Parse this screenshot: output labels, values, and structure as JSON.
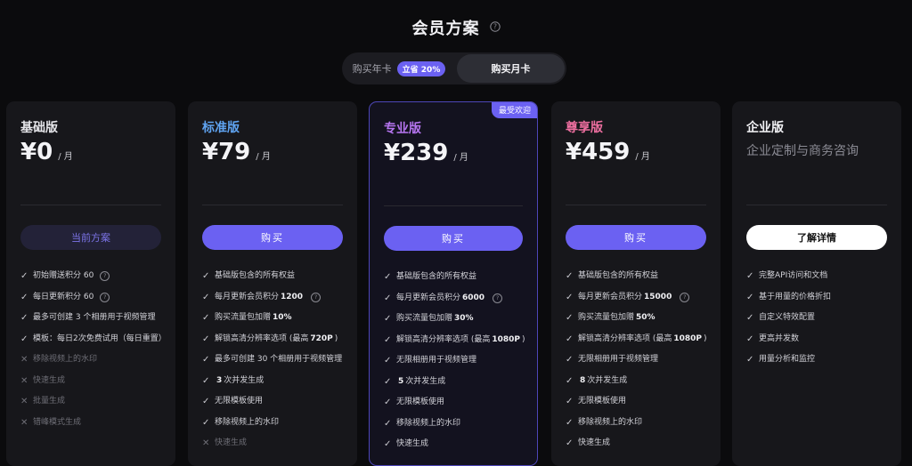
{
  "header": {
    "title": "会员方案"
  },
  "toggle": {
    "yearly": "购买年卡",
    "discount": "立省 20%",
    "monthly": "购买月卡"
  },
  "colors": {
    "accent": "#6b61f2",
    "basic": "#e6e6ea",
    "standard": "#5fa3f0",
    "pro": "#b675f0",
    "premium": "#ee6fa0",
    "enterprise": "#f2f2f5"
  },
  "plans": [
    {
      "name": "基础版",
      "price": "¥0",
      "unit": "/ 月",
      "cta": "当前方案",
      "features": [
        {
          "pre": "初始赠送积分 60",
          "bold": "",
          "post": "",
          "help": true,
          "ok": true
        },
        {
          "pre": "每日更新积分 60",
          "bold": "",
          "post": "",
          "help": true,
          "ok": true
        },
        {
          "pre": "最多可创建 3 个相册用于视频管理",
          "bold": "",
          "post": "",
          "help": false,
          "ok": true
        },
        {
          "pre": "模板：每日2次免费试用（每日重置）",
          "bold": "",
          "post": "",
          "help": false,
          "ok": true
        },
        {
          "pre": "移除视频上的水印",
          "bold": "",
          "post": "",
          "help": false,
          "ok": false
        },
        {
          "pre": "快速生成",
          "bold": "",
          "post": "",
          "help": false,
          "ok": false
        },
        {
          "pre": "批量生成",
          "bold": "",
          "post": "",
          "help": false,
          "ok": false
        },
        {
          "pre": "错峰模式生成",
          "bold": "",
          "post": "",
          "help": false,
          "ok": false
        }
      ]
    },
    {
      "name": "标准版",
      "price": "¥79",
      "unit": "/ 月",
      "cta": "购买",
      "features": [
        {
          "pre": "基础版包含的所有权益",
          "bold": "",
          "post": "",
          "help": false,
          "ok": true
        },
        {
          "pre": "每月更新会员积分",
          "bold": "1200",
          "post": "",
          "help": true,
          "ok": true
        },
        {
          "pre": "购买流量包加赠",
          "bold": "10%",
          "post": "",
          "help": false,
          "ok": true
        },
        {
          "pre": "解锁高清分辨率选项 (最高",
          "bold": "720P",
          "post": ")",
          "help": false,
          "ok": true
        },
        {
          "pre": "最多可创建 30 个相册用于视频管理",
          "bold": "",
          "post": "",
          "help": false,
          "ok": true
        },
        {
          "pre": "",
          "bold": "3",
          "post": "次并发生成",
          "help": false,
          "ok": true
        },
        {
          "pre": "无限模板使用",
          "bold": "",
          "post": "",
          "help": false,
          "ok": true
        },
        {
          "pre": "移除视频上的水印",
          "bold": "",
          "post": "",
          "help": false,
          "ok": true
        },
        {
          "pre": "快速生成",
          "bold": "",
          "post": "",
          "help": false,
          "ok": false
        }
      ]
    },
    {
      "name": "专业版",
      "price": "¥239",
      "unit": "/ 月",
      "cta": "购买",
      "badge": "最受欢迎",
      "features": [
        {
          "pre": "基础版包含的所有权益",
          "bold": "",
          "post": "",
          "help": false,
          "ok": true
        },
        {
          "pre": "每月更新会员积分",
          "bold": "6000",
          "post": "",
          "help": true,
          "ok": true
        },
        {
          "pre": "购买流量包加赠",
          "bold": "30%",
          "post": "",
          "help": false,
          "ok": true
        },
        {
          "pre": "解锁高清分辨率选项 (最高",
          "bold": "1080P",
          "post": ")",
          "help": false,
          "ok": true
        },
        {
          "pre": "无限相册用于视频管理",
          "bold": "",
          "post": "",
          "help": false,
          "ok": true
        },
        {
          "pre": "",
          "bold": "5",
          "post": "次并发生成",
          "help": false,
          "ok": true
        },
        {
          "pre": "无限模板使用",
          "bold": "",
          "post": "",
          "help": false,
          "ok": true
        },
        {
          "pre": "移除视频上的水印",
          "bold": "",
          "post": "",
          "help": false,
          "ok": true
        },
        {
          "pre": "快速生成",
          "bold": "",
          "post": "",
          "help": false,
          "ok": true
        }
      ]
    },
    {
      "name": "尊享版",
      "price": "¥459",
      "unit": "/ 月",
      "cta": "购买",
      "features": [
        {
          "pre": "基础版包含的所有权益",
          "bold": "",
          "post": "",
          "help": false,
          "ok": true
        },
        {
          "pre": "每月更新会员积分",
          "bold": "15000",
          "post": "",
          "help": true,
          "ok": true
        },
        {
          "pre": "购买流量包加赠",
          "bold": "50%",
          "post": "",
          "help": false,
          "ok": true
        },
        {
          "pre": "解锁高清分辨率选项 (最高",
          "bold": "1080P",
          "post": ")",
          "help": false,
          "ok": true
        },
        {
          "pre": "无限相册用于视频管理",
          "bold": "",
          "post": "",
          "help": false,
          "ok": true
        },
        {
          "pre": "",
          "bold": "8",
          "post": "次并发生成",
          "help": false,
          "ok": true
        },
        {
          "pre": "无限模板使用",
          "bold": "",
          "post": "",
          "help": false,
          "ok": true
        },
        {
          "pre": "移除视频上的水印",
          "bold": "",
          "post": "",
          "help": false,
          "ok": true
        },
        {
          "pre": "快速生成",
          "bold": "",
          "post": "",
          "help": false,
          "ok": true
        }
      ]
    },
    {
      "name": "企业版",
      "subtitle": "企业定制与商务咨询",
      "cta": "了解详情",
      "features": [
        {
          "pre": "完整API访问和文档",
          "bold": "",
          "post": "",
          "help": false,
          "ok": true
        },
        {
          "pre": "基于用量的价格折扣",
          "bold": "",
          "post": "",
          "help": false,
          "ok": true
        },
        {
          "pre": "自定义特效配置",
          "bold": "",
          "post": "",
          "help": false,
          "ok": true
        },
        {
          "pre": "更高并发数",
          "bold": "",
          "post": "",
          "help": false,
          "ok": true
        },
        {
          "pre": "用量分析和监控",
          "bold": "",
          "post": "",
          "help": false,
          "ok": true
        }
      ]
    }
  ]
}
